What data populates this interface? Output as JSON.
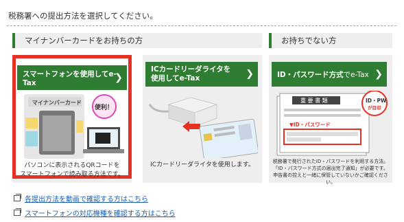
{
  "page": {
    "title": "税務署への提出方法を選択してください。"
  },
  "sections": {
    "have_card": {
      "label": "マイナンバーカードをお持ちの方"
    },
    "no_card": {
      "label": "お持ちでない方"
    }
  },
  "options": [
    {
      "button_label": "スマートフォンを使用してe-Tax",
      "illustration_text": "マイナンバーカード",
      "badge_text": "便利！",
      "description_line1": "パソコンに表示されるQRコードを",
      "description_line2": "スマートフォンで読み取る方法です。"
    },
    {
      "button_line1": "ICカードリーダライタを",
      "button_line2": "使用してe-Tax",
      "description": "ICカードリーダライタを使用します。"
    },
    {
      "button_bold": "ID・パスワード方式",
      "button_rest": "でe-Tax",
      "doc_title": "重 要 書 類",
      "doc_id_label": "▼ID・パスワード",
      "badge_line1": "ID・PW",
      "badge_line2": "が目印",
      "description_line1": "税務署で発行されたID・パスワードを利用する方法。",
      "description_line2": "「ID・パスワード方式の届出完了通知」が必要です。",
      "description_line3": "申告書の控えと一緒に保管していないかご確認ください。"
    }
  ],
  "links": [
    {
      "label": "各提出方法を動画で確認する方はこちら"
    },
    {
      "label": "スマートフォンの対応機種を確認する方はこちら"
    }
  ],
  "colors": {
    "accent_green": "#2e7d32",
    "highlight_red": "#e53024",
    "divider_orange": "#f0a030",
    "link_blue": "#1a5fb4"
  }
}
